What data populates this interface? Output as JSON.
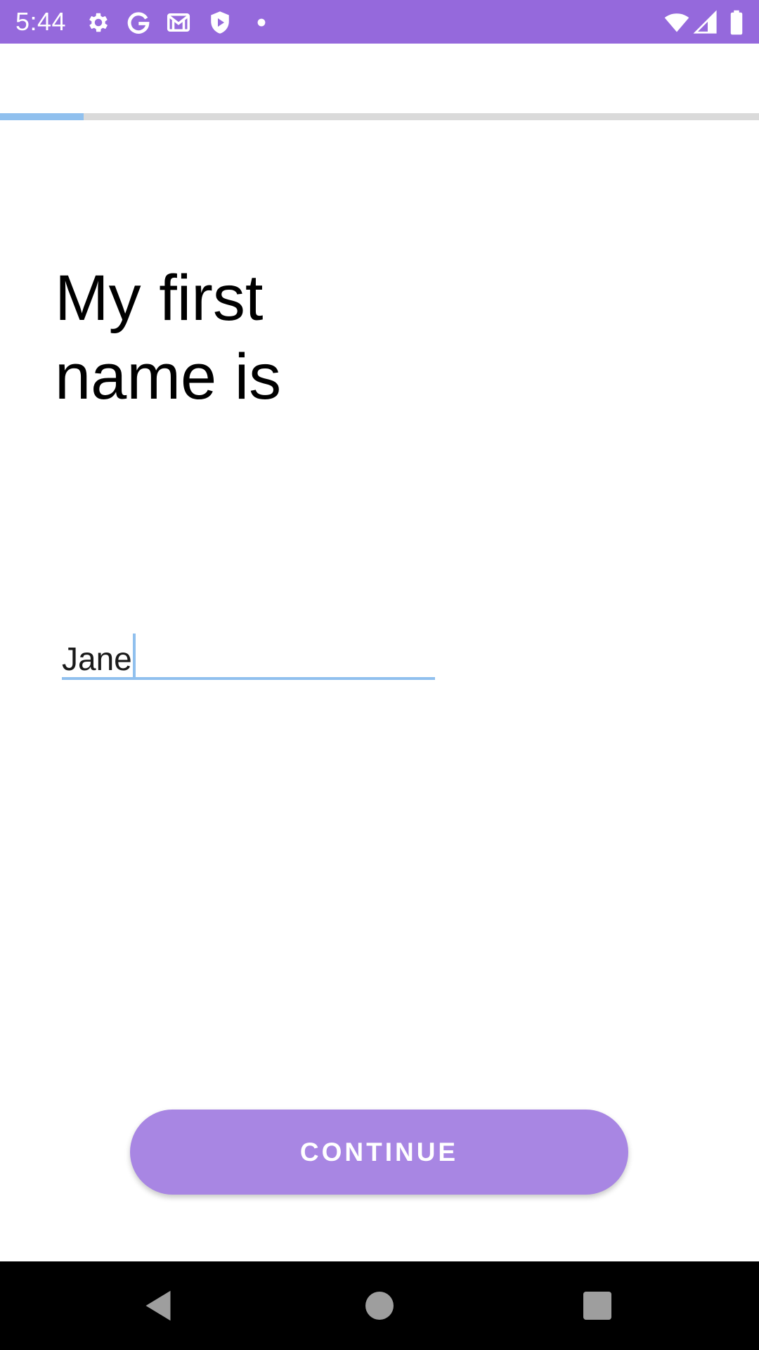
{
  "status_bar": {
    "time": "5:44",
    "left_icons": [
      "gear-icon",
      "google-icon",
      "gmail-icon",
      "shield-play-icon",
      "dot-icon"
    ],
    "right_icons": [
      "wifi-icon",
      "signal-icon",
      "battery-icon"
    ],
    "color": "#9569dc"
  },
  "progress": {
    "value": 0.11,
    "fill_color": "#90c0ee",
    "track_color": "#dadada"
  },
  "main": {
    "title_line_1": "My first",
    "title_line_2": "name is",
    "name_field": {
      "value": "Jane",
      "accent_color": "#90c0ee"
    },
    "continue_label": "CONTINUE",
    "continue_color": "#a886e3"
  },
  "nav_bar": {
    "buttons": [
      "back-icon",
      "home-icon",
      "recents-icon"
    ]
  }
}
